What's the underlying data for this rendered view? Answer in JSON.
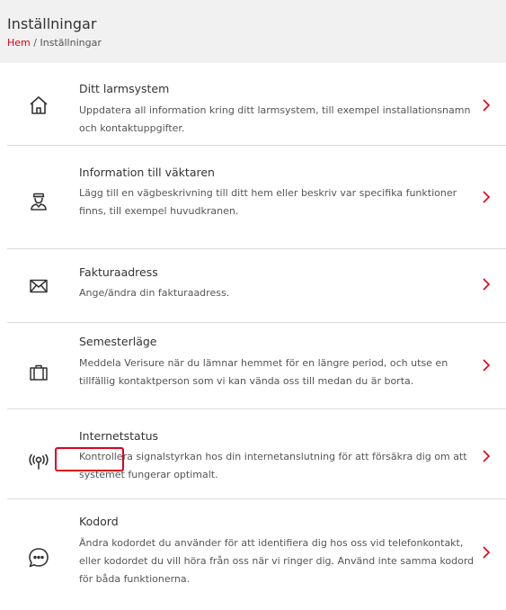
{
  "header": {
    "title": "Inställningar",
    "breadcrumb": {
      "home": "Hem",
      "separator": "/",
      "current": "Inställningar"
    }
  },
  "items": [
    {
      "icon": "house-icon",
      "title": "Ditt larmsystem",
      "desc": "Uppdatera all information kring ditt larmsystem, till exempel installationsnamn och kontaktuppgifter."
    },
    {
      "icon": "guard-icon",
      "title": "Information till väktaren",
      "desc": "Lägg till en vägbeskrivning till ditt hem eller beskriv var specifika funktioner finns, till exempel huvudkranen."
    },
    {
      "icon": "envelope-icon",
      "title": "Fakturaadress",
      "desc": "Ange/ändra din fakturaadress."
    },
    {
      "icon": "suitcase-icon",
      "title": "Semesterläge",
      "desc": "Meddela Verisure när du lämnar hemmet för en längre period, och utse en tillfällig kontaktperson som vi kan vända oss till medan du är borta."
    },
    {
      "icon": "signal-icon",
      "title": "Internetstatus",
      "desc": "Kontrollera signalstyrkan hos din internetanslutning för att försäkra dig om att systemet fungerar optimalt."
    },
    {
      "icon": "chat-bubble-icon",
      "title": "Kodord",
      "desc": "Ändra kodordet du använder för att identifiera dig hos oss vid telefonkontakt, eller kodordet du vill höra från oss när vi ringer dig. Använd inte samma kodord för båda funktionerna."
    }
  ],
  "colors": {
    "accent": "#e0001a",
    "header_bg": "#f1f1f1",
    "divider": "#dcdcdc",
    "text": "#333333"
  }
}
